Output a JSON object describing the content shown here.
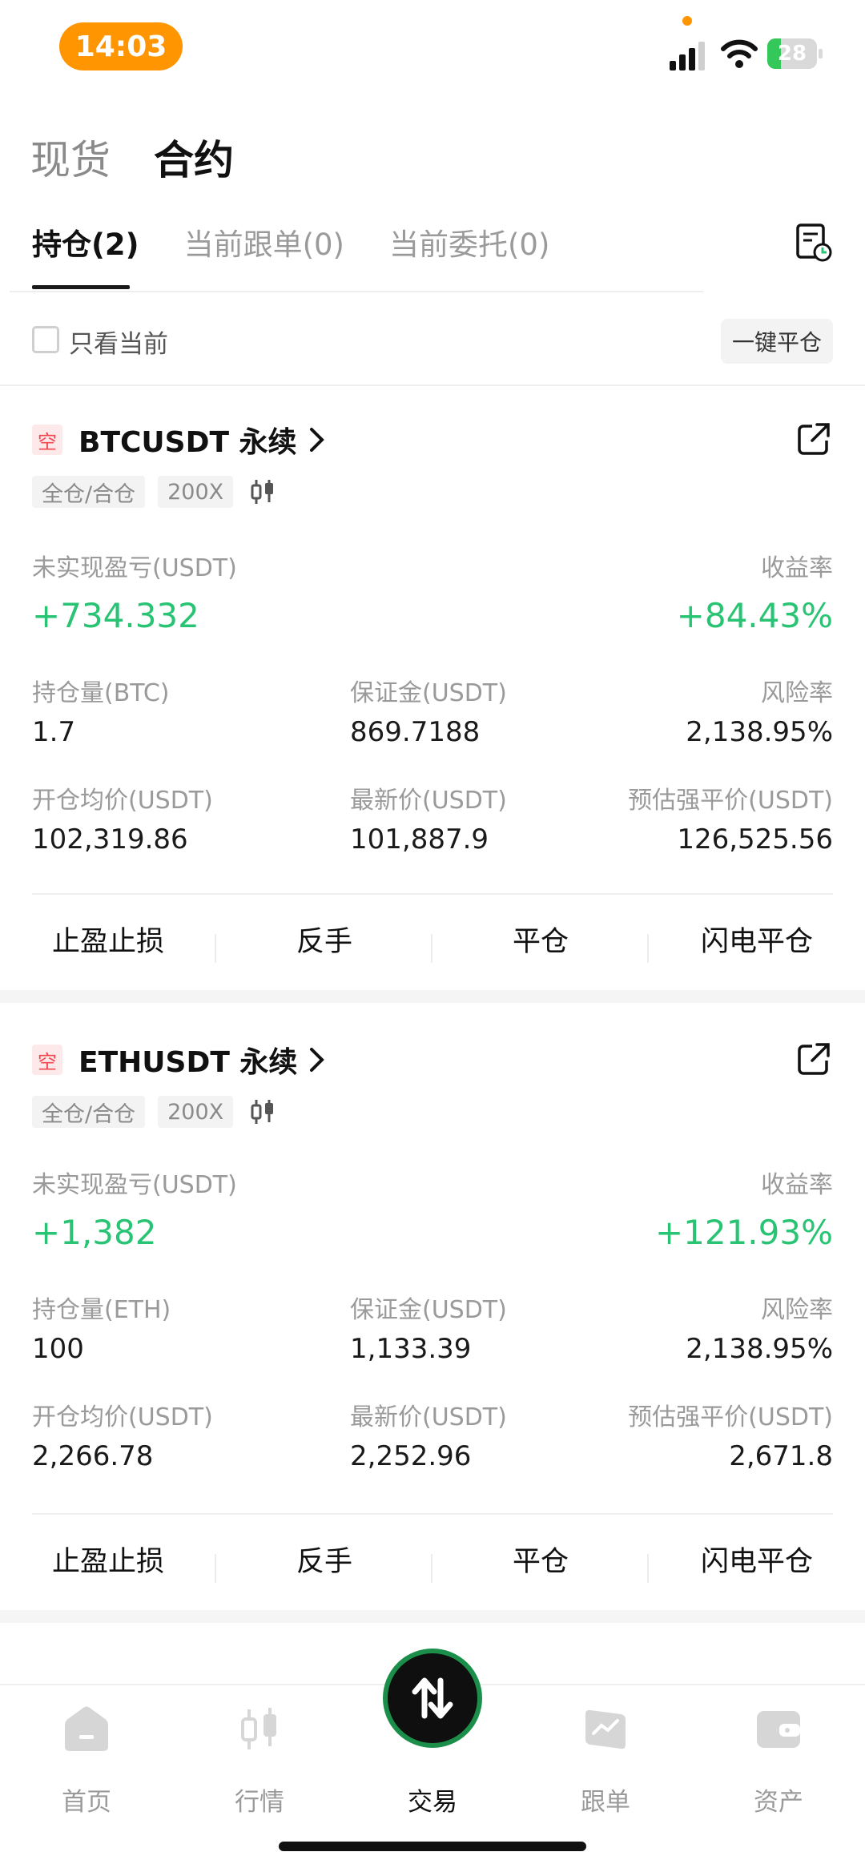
{
  "status_bar": {
    "time": "14:03",
    "battery": "28",
    "battery_level": 0.28
  },
  "top_tabs": [
    {
      "label": "现货",
      "active": false
    },
    {
      "label": "合约",
      "active": true
    }
  ],
  "sub_tabs": [
    {
      "label": "持仓(2)",
      "active": true
    },
    {
      "label": "当前跟单(0)",
      "active": false
    },
    {
      "label": "当前委托(0)",
      "active": false
    }
  ],
  "filter": {
    "checkbox_label": "只看当前",
    "checked": false,
    "close_all_label": "一键平仓"
  },
  "positions": [
    {
      "side": "空",
      "symbol": "BTCUSDT 永续",
      "margin_mode": "全仓/合仓",
      "leverage": "200X",
      "pnl_label": "未实现盈亏(USDT)",
      "pnl_value": "+734.332",
      "roe_label": "收益率",
      "roe_value": "+84.43%",
      "size_label": "持仓量(BTC)",
      "size_value": "1.7",
      "margin_label": "保证金(USDT)",
      "margin_value": "869.7188",
      "risk_label": "风险率",
      "risk_value": "2,138.95%",
      "entry_label": "开仓均价(USDT)",
      "entry_value": "102,319.86",
      "mark_label": "最新价(USDT)",
      "mark_value": "101,887.9",
      "liq_label": "预估强平价(USDT)",
      "liq_value": "126,525.56",
      "actions": [
        "止盈止损",
        "反手",
        "平仓",
        "闪电平仓"
      ]
    },
    {
      "side": "空",
      "symbol": "ETHUSDT 永续",
      "margin_mode": "全仓/合仓",
      "leverage": "200X",
      "pnl_label": "未实现盈亏(USDT)",
      "pnl_value": "+1,382",
      "roe_label": "收益率",
      "roe_value": "+121.93%",
      "size_label": "持仓量(ETH)",
      "size_value": "100",
      "margin_label": "保证金(USDT)",
      "margin_value": "1,133.39",
      "risk_label": "风险率",
      "risk_value": "2,138.95%",
      "entry_label": "开仓均价(USDT)",
      "entry_value": "2,266.78",
      "mark_label": "最新价(USDT)",
      "mark_value": "2,252.96",
      "liq_label": "预估强平价(USDT)",
      "liq_value": "2,671.8",
      "actions": [
        "止盈止损",
        "反手",
        "平仓",
        "闪电平仓"
      ]
    }
  ],
  "bottom_nav": [
    {
      "label": "首页",
      "icon": "home-icon",
      "active": false
    },
    {
      "label": "行情",
      "icon": "market-icon",
      "active": false
    },
    {
      "label": "交易",
      "icon": "trade-icon",
      "active": true
    },
    {
      "label": "跟单",
      "icon": "copy-trade-icon",
      "active": false
    },
    {
      "label": "资产",
      "icon": "wallet-icon",
      "active": false
    }
  ],
  "colors": {
    "profit": "#28c474",
    "short_badge": "#f0484e",
    "accent": "#ff9500"
  }
}
